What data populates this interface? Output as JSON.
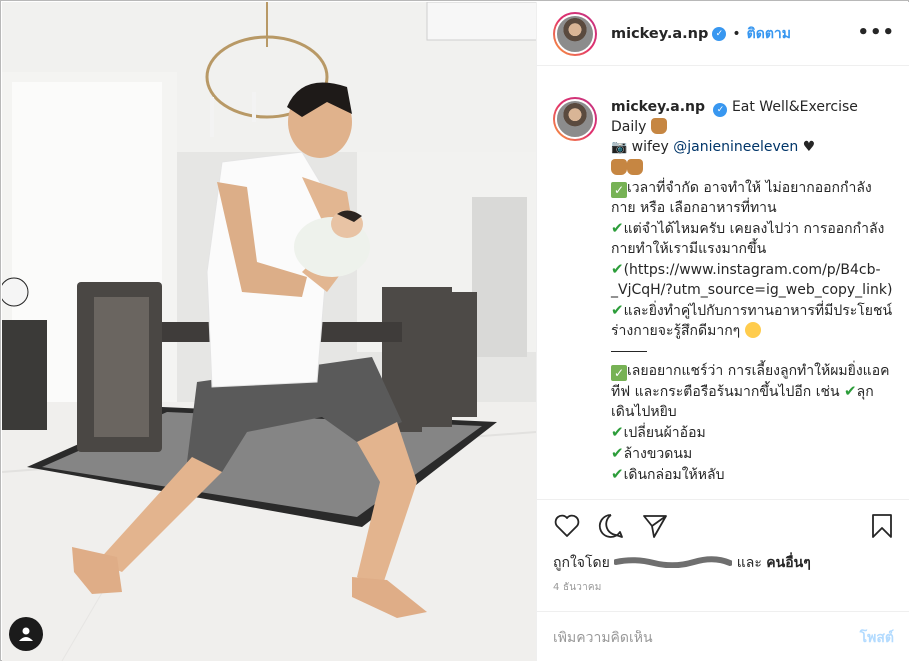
{
  "header": {
    "username": "mickey.a.np",
    "verified_icon": "verified-badge-icon",
    "separator": "•",
    "follow_label": "ติดตาม",
    "more_label": "•••"
  },
  "caption": {
    "username": "mickey.a.np",
    "lines": {
      "l1": "Eat Well&Exercise Daily",
      "l2a": "wifey",
      "l2_mention": "@janienineeleven",
      "l2b": "♥",
      "l3": "เวลาที่จำกัด อาจทำให้ ไม่อยากออกกำลังกาย หรือ เลือกอาหารที่ทาน",
      "l4": "แต่จำได้ไหมครับ เคยลงไปว่า การออกกำลังกายทำให้เรามีแรงมากขึ้น",
      "l5": "(https://www.instagram.com/p/B4cb-_VjCqH/?utm_source=ig_web_copy_link)",
      "l6": "และยิ่งทำคู่ไปกับการทานอาหารที่มีประโยชน์ ร่างกายจะรู้สึกดีมากๆ",
      "l7": "เลยอยากแชร์ว่า การเลี้ยงลูกทำให้ผมยิ่งแอคทีฟ และกระตือรือร้นมากขึ้นไปอีก เช่น",
      "l7b": "ลุกเดินไปหยิบ",
      "l8": "เปลี่ยนผ้าอ้อม",
      "l9": "ล้างขวดนม",
      "l10": "เดินกล่อมให้หลับ"
    }
  },
  "likes": {
    "prefix": "ถูกใจโดย",
    "and": "และ",
    "others": "คนอื่นๆ",
    "hidden_name": "oscribbled name"
  },
  "date": "4 ธันวาคม",
  "comment": {
    "placeholder": "เพิ่มความคิดเห็น",
    "post_label": "โพสต์"
  },
  "colors": {
    "accent": "#3897f0",
    "text": "#262626",
    "muted": "#999999",
    "check": "#77b255"
  }
}
